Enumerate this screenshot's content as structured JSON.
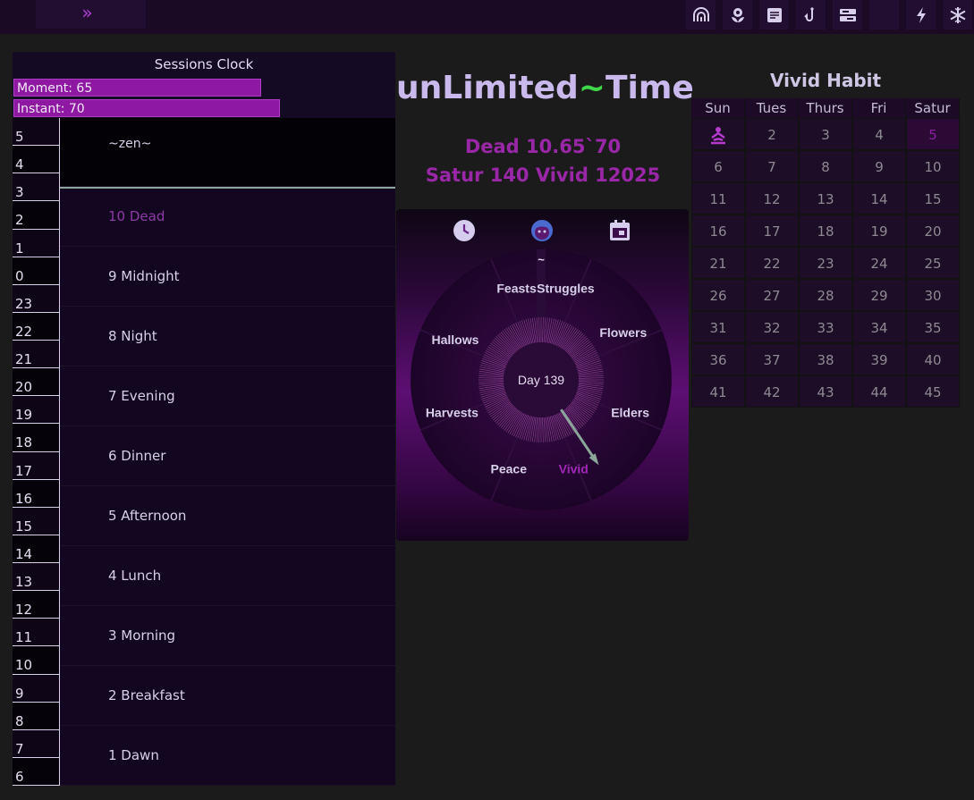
{
  "topbar": {
    "toggle_glyph": "»",
    "icons": [
      "rainbow-icon",
      "flower-icon",
      "note-icon",
      "hook-icon",
      "sliders-icon",
      "moon-icon",
      "bolt-icon",
      "snowflake-icon"
    ]
  },
  "sessions": {
    "title": "Sessions Clock",
    "moment_label": "Moment: 65",
    "moment_value": 65,
    "instant_label": "Instant: 70",
    "instant_value": 70,
    "hours": [
      "5",
      "4",
      "3",
      "2",
      "1",
      "0",
      "23",
      "22",
      "21",
      "20",
      "19",
      "18",
      "17",
      "16",
      "15",
      "14",
      "13",
      "12",
      "11",
      "10",
      "9",
      "8",
      "7",
      "6"
    ],
    "rows": [
      "~zen~",
      "10 Dead",
      "9 Midnight",
      "8 Night",
      "7 Evening",
      "6 Dinner",
      "5 Afternoon",
      "4 Lunch",
      "3 Morning",
      "2 Breakfast",
      "1 Dawn"
    ],
    "current_row": "10 Dead"
  },
  "header": {
    "title_a": "unLimited",
    "title_tilde": "~",
    "title_b": "Time",
    "line1": "Dead 10.65`70",
    "line2": "Satur 140 Vivid 12025"
  },
  "wheel": {
    "tools": [
      "clock-icon",
      "face-icon",
      "calendar-icon"
    ],
    "center_label": "Day 139",
    "top_marker": "~",
    "segments": [
      "Feasts",
      "Struggles",
      "Flowers",
      "Elders",
      "Vivid",
      "Peace",
      "Harvests",
      "Hallows"
    ],
    "active_segment": "Vivid"
  },
  "habit": {
    "title": "Vivid Habit",
    "days": [
      "Sun",
      "Tues",
      "Thurs",
      "Fri",
      "Satur"
    ],
    "weeks": [
      [
        "",
        "2",
        "3",
        "4",
        "5"
      ],
      [
        "6",
        "7",
        "8",
        "9",
        "10"
      ],
      [
        "11",
        "12",
        "13",
        "14",
        "15"
      ],
      [
        "16",
        "17",
        "18",
        "19",
        "20"
      ],
      [
        "21",
        "22",
        "23",
        "24",
        "25"
      ],
      [
        "26",
        "27",
        "28",
        "29",
        "30"
      ],
      [
        "31",
        "32",
        "33",
        "34",
        "35"
      ],
      [
        "36",
        "37",
        "38",
        "39",
        "40"
      ],
      [
        "41",
        "42",
        "43",
        "44",
        "45"
      ]
    ],
    "first_cell_icon": "meditation-icon",
    "highlighted_day": "5"
  },
  "colors": {
    "accent": "#8e18a2",
    "title_tilde": "#3fd848",
    "summary": "#9a27a8"
  }
}
